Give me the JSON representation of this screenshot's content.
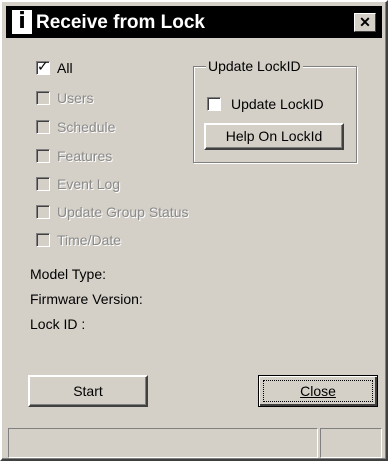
{
  "window": {
    "title": "Receive from Lock",
    "app_icon": "lock-app-icon",
    "close_glyph": "✕"
  },
  "options": [
    {
      "label": "All",
      "checked": true,
      "enabled": true
    },
    {
      "label": "Users",
      "checked": false,
      "enabled": false
    },
    {
      "label": "Schedule",
      "checked": false,
      "enabled": false
    },
    {
      "label": "Features",
      "checked": false,
      "enabled": false
    },
    {
      "label": "Event Log",
      "checked": false,
      "enabled": false
    },
    {
      "label": "Update Group Status",
      "checked": false,
      "enabled": false
    },
    {
      "label": "Time/Date",
      "checked": false,
      "enabled": false
    }
  ],
  "group": {
    "title": "Update LockID",
    "checkbox_label": "Update LockID",
    "checkbox_checked": false,
    "help_button": "Help On LockId"
  },
  "info": {
    "model_type": "Model Type:",
    "firmware_version": "Firmware Version:",
    "lock_id": "Lock ID :"
  },
  "buttons": {
    "start": "Start",
    "close": "Close"
  },
  "colors": {
    "face": "#d4d0c8",
    "titlebar": "#000000",
    "disabled_text": "#8a8a8a"
  }
}
